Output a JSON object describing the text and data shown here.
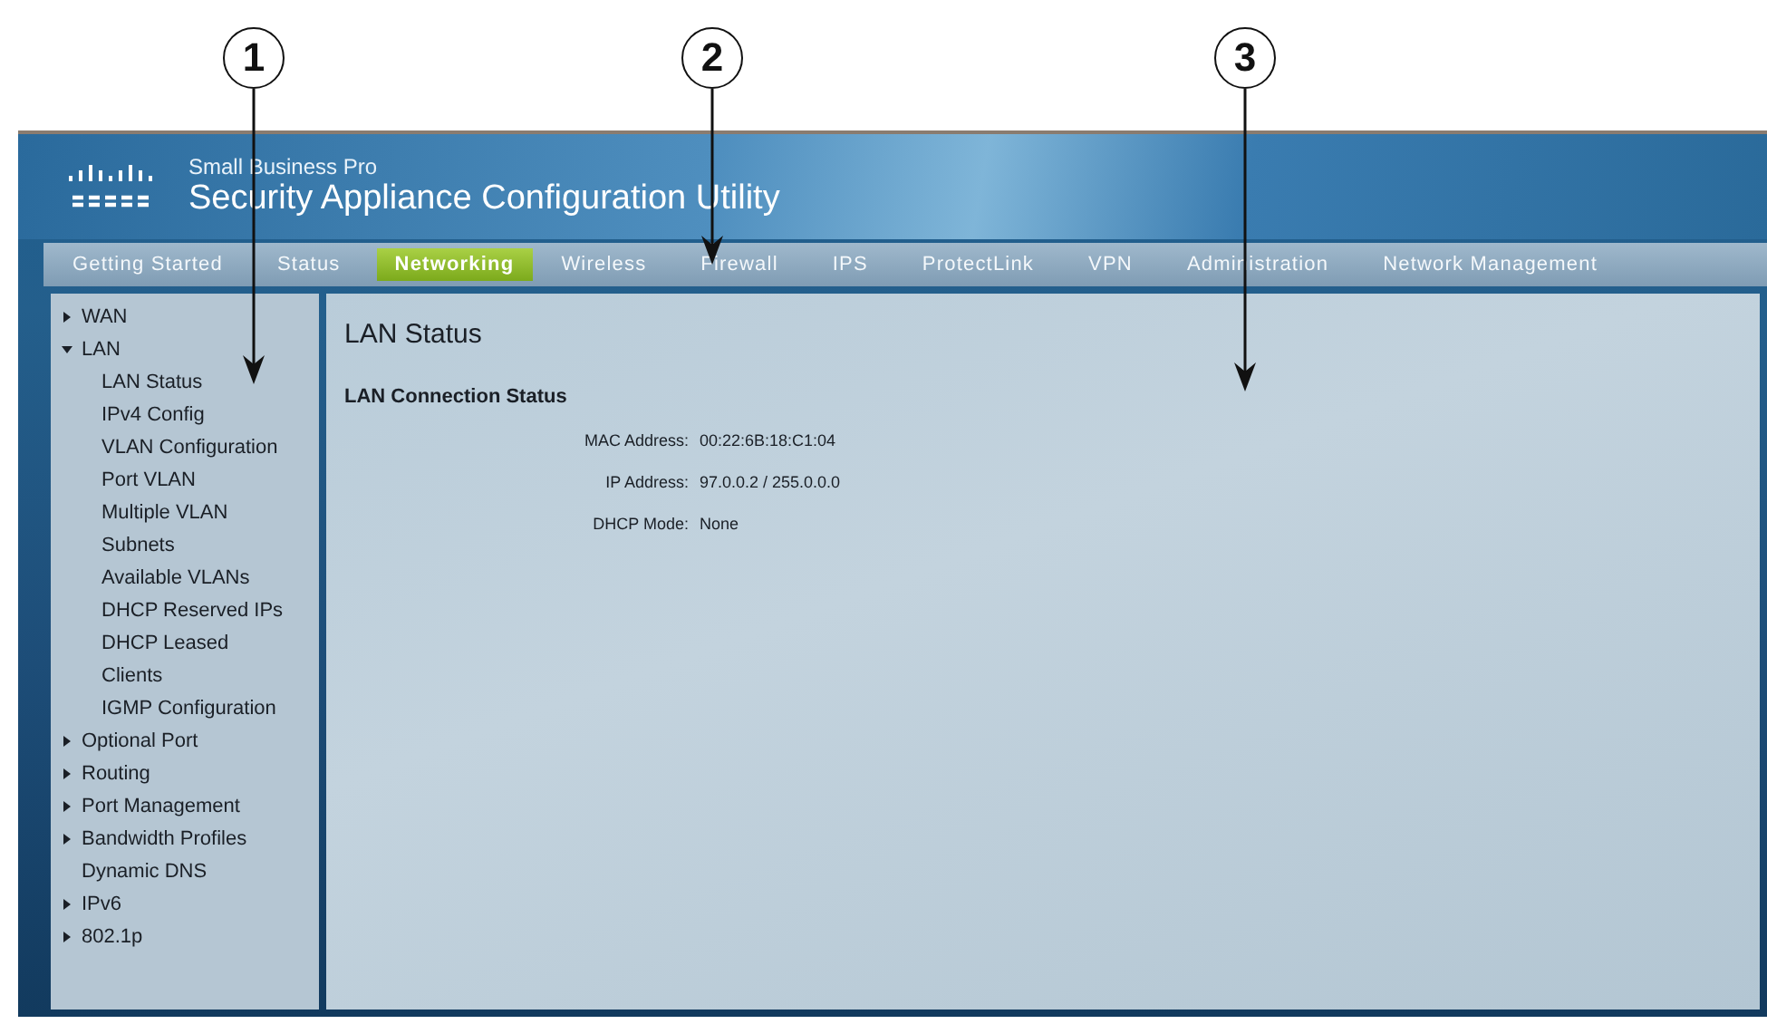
{
  "callouts": [
    {
      "number": "1"
    },
    {
      "number": "2"
    },
    {
      "number": "3"
    }
  ],
  "header": {
    "subtitle": "Small Business Pro",
    "title": "Security Appliance Configuration Utility"
  },
  "tabs": [
    {
      "label": "Getting Started",
      "selected": false
    },
    {
      "label": "Status",
      "selected": false
    },
    {
      "label": "Networking",
      "selected": true
    },
    {
      "label": "Wireless",
      "selected": false
    },
    {
      "label": "Firewall",
      "selected": false
    },
    {
      "label": "IPS",
      "selected": false
    },
    {
      "label": "ProtectLink",
      "selected": false
    },
    {
      "label": "VPN",
      "selected": false
    },
    {
      "label": "Administration",
      "selected": false
    },
    {
      "label": "Network Management",
      "selected": false
    }
  ],
  "sidebar": {
    "items": [
      {
        "label": "WAN",
        "expanded": false
      },
      {
        "label": "LAN",
        "expanded": true,
        "children": [
          {
            "label": "LAN Status"
          },
          {
            "label": "IPv4 Config"
          },
          {
            "label": "VLAN Configuration"
          },
          {
            "label": "Port VLAN"
          },
          {
            "label": "Multiple VLAN"
          },
          {
            "label": "Subnets"
          },
          {
            "label": "Available VLANs"
          },
          {
            "label": "DHCP Reserved IPs"
          },
          {
            "label": "DHCP Leased"
          },
          {
            "label": "Clients"
          },
          {
            "label": "IGMP Configuration"
          }
        ]
      },
      {
        "label": "Optional Port",
        "expanded": false
      },
      {
        "label": "Routing",
        "expanded": false
      },
      {
        "label": "Port Management",
        "expanded": false
      },
      {
        "label": "Bandwidth Profiles",
        "expanded": false
      },
      {
        "label": "Dynamic DNS"
      },
      {
        "label": "IPv6",
        "expanded": false
      },
      {
        "label": "802.1p",
        "expanded": false
      }
    ]
  },
  "content": {
    "title": "LAN Status",
    "section": "LAN Connection Status",
    "fields": [
      {
        "label": "MAC Address:",
        "value": "00:22:6B:18:C1:04"
      },
      {
        "label": "IP Address:",
        "value": "97.0.0.2 / 255.0.0.0"
      },
      {
        "label": "DHCP Mode:",
        "value": "None"
      }
    ]
  }
}
